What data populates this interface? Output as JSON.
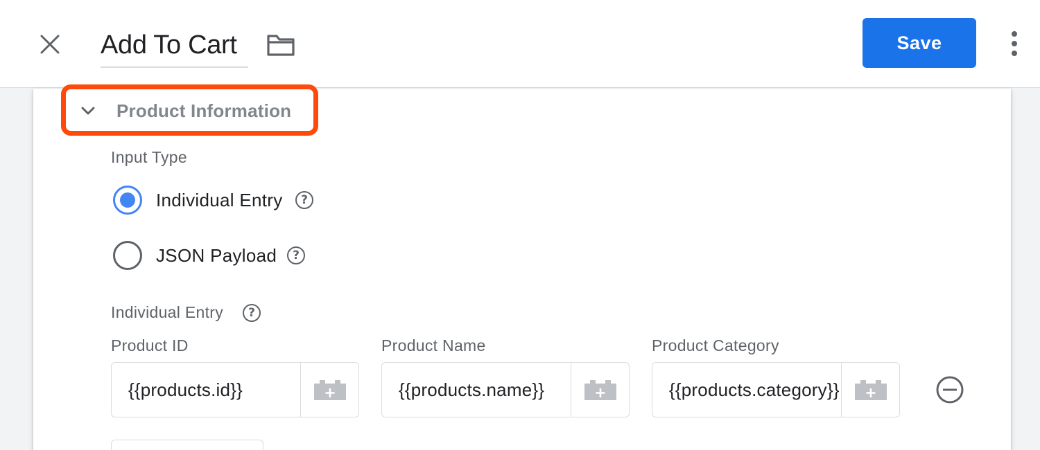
{
  "header": {
    "title": "Add To Cart",
    "save_label": "Save",
    "close_icon": "close-icon",
    "folder_icon": "folder-icon",
    "more_icon": "more-vertical-icon"
  },
  "section": {
    "title": "Product Information",
    "expanded": true,
    "highlight_color": "#ff4a0c"
  },
  "input_type": {
    "label": "Input Type",
    "options": [
      {
        "label": "Individual Entry",
        "selected": true
      },
      {
        "label": "JSON Payload",
        "selected": false
      }
    ]
  },
  "individual_entry": {
    "label": "Individual Entry",
    "fields": [
      {
        "label": "Product ID",
        "value": "{{products.id}}"
      },
      {
        "label": "Product Name",
        "value": "{{products.name}}"
      },
      {
        "label": "Product Category",
        "value": "{{products.category}}"
      }
    ]
  },
  "colors": {
    "primary": "#1a73e8",
    "radio_selected": "#4285f4",
    "highlight": "#ff4a0c"
  }
}
